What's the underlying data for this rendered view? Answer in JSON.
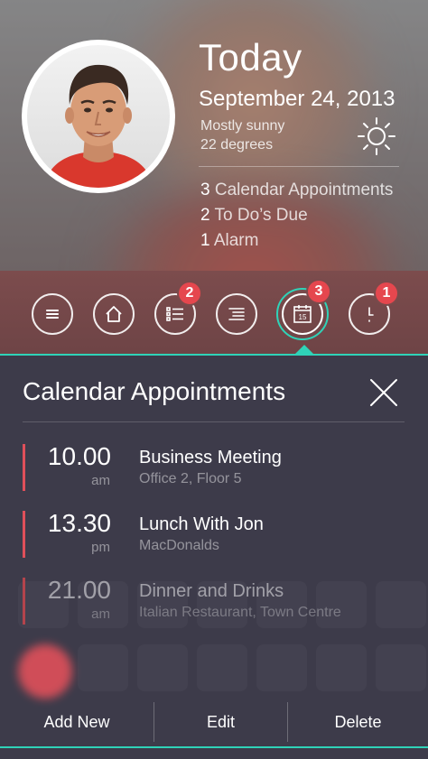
{
  "header": {
    "title": "Today",
    "date": "September 24, 2013",
    "weather": {
      "description": "Mostly sunny",
      "temperature": "22 degrees",
      "icon": "sun-icon"
    },
    "summary": [
      {
        "count": "3",
        "label": "Calendar Appointments"
      },
      {
        "count": "2",
        "label": "To Do’s Due"
      },
      {
        "count": "1",
        "label": "Alarm"
      }
    ]
  },
  "nav": {
    "items": [
      {
        "icon": "menu-icon",
        "badge": null
      },
      {
        "icon": "home-icon",
        "badge": null
      },
      {
        "icon": "todo-list-icon",
        "badge": "2"
      },
      {
        "icon": "notes-icon",
        "badge": null
      },
      {
        "icon": "calendar-icon",
        "badge": "3",
        "calendar_day": "15",
        "active": true
      },
      {
        "icon": "clock-icon",
        "badge": "1"
      }
    ],
    "accent_color": "#2fd3b8",
    "badge_color": "#e5474e"
  },
  "panel": {
    "title": "Calendar Appointments",
    "appointments": [
      {
        "time": "10.00",
        "ampm": "am",
        "title": "Business Meeting",
        "place": "Office 2, Floor 5"
      },
      {
        "time": "13.30",
        "ampm": "pm",
        "title": "Lunch With Jon",
        "place": "MacDonalds"
      },
      {
        "time": "21.00",
        "ampm": "am",
        "title": "Dinner and Drinks",
        "place": "Italian Restaurant, Town Centre"
      }
    ],
    "actions": {
      "add": "Add New",
      "edit": "Edit",
      "delete": "Delete"
    },
    "marker_color": "#e0505a"
  }
}
